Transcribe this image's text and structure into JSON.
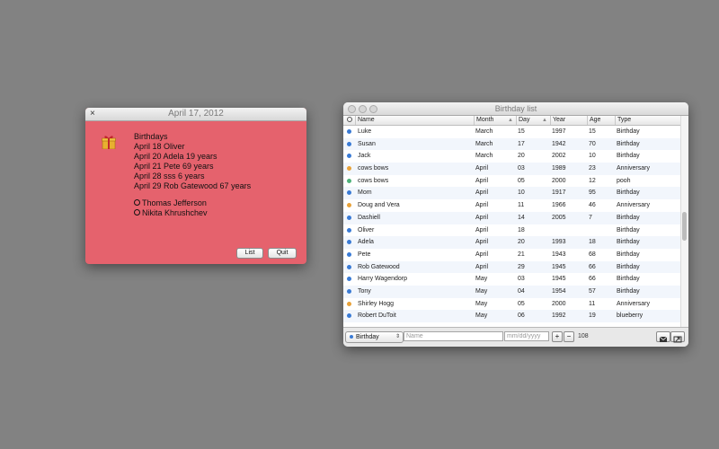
{
  "reminder": {
    "title": "April 17, 2012",
    "close_glyph": "×",
    "lines": [
      "Birthdays",
      "April 18 Oliver",
      "April 20 Adela 19 years",
      "April 21 Pete 69 years",
      "April 28 sss 6 years",
      "April 29 Rob Gatewood 67 years"
    ],
    "people": [
      "Thomas Jefferson",
      "Nikita Khrushchev"
    ],
    "list_button": "List",
    "quit_button": "Quit",
    "icon": "gift-icon"
  },
  "list_window": {
    "title": "Birthday list",
    "columns": [
      "Name",
      "Month",
      "Day",
      "Year",
      "Age",
      "Type"
    ],
    "rows": [
      {
        "name": "Luke",
        "month": "March",
        "day": "15",
        "year": "1997",
        "age": "15",
        "type": "Birthday",
        "status": "blue"
      },
      {
        "name": "Susan",
        "month": "March",
        "day": "17",
        "year": "1942",
        "age": "70",
        "type": "Birthday",
        "status": "blue"
      },
      {
        "name": "Jack",
        "month": "March",
        "day": "20",
        "year": "2002",
        "age": "10",
        "type": "Birthday",
        "status": "blue"
      },
      {
        "name": "cows bows",
        "month": "April",
        "day": "03",
        "year": "1989",
        "age": "23",
        "type": "Anniversary",
        "status": "orange"
      },
      {
        "name": "cows bows",
        "month": "April",
        "day": "05",
        "year": "2000",
        "age": "12",
        "type": "pooh",
        "status": "green"
      },
      {
        "name": "Mom",
        "month": "April",
        "day": "10",
        "year": "1917",
        "age": "95",
        "type": "Birthday",
        "status": "blue"
      },
      {
        "name": "Doug and Vera",
        "month": "April",
        "day": "11",
        "year": "1966",
        "age": "46",
        "type": "Anniversary",
        "status": "orange"
      },
      {
        "name": "Dashiell",
        "month": "April",
        "day": "14",
        "year": "2005",
        "age": "7",
        "type": "Birthday",
        "status": "blue"
      },
      {
        "name": "Oliver",
        "month": "April",
        "day": "18",
        "year": "",
        "age": "",
        "type": "Birthday",
        "status": "blue"
      },
      {
        "name": "Adela",
        "month": "April",
        "day": "20",
        "year": "1993",
        "age": "18",
        "type": "Birthday",
        "status": "blue"
      },
      {
        "name": "Pete",
        "month": "April",
        "day": "21",
        "year": "1943",
        "age": "68",
        "type": "Birthday",
        "status": "blue"
      },
      {
        "name": "Rob Gatewood",
        "month": "April",
        "day": "29",
        "year": "1945",
        "age": "66",
        "type": "Birthday",
        "status": "blue"
      },
      {
        "name": "Harry Wagendorp",
        "month": "May",
        "day": "03",
        "year": "1945",
        "age": "66",
        "type": "Birthday",
        "status": "blue"
      },
      {
        "name": "Tony",
        "month": "May",
        "day": "04",
        "year": "1954",
        "age": "57",
        "type": "Birthday",
        "status": "blue"
      },
      {
        "name": "Shirley Hogg",
        "month": "May",
        "day": "05",
        "year": "2000",
        "age": "11",
        "type": "Anniversary",
        "status": "orange"
      },
      {
        "name": "Robert DuToit",
        "month": "May",
        "day": "06",
        "year": "1992",
        "age": "19",
        "type": "blueberry",
        "status": "blue"
      }
    ],
    "toolbar": {
      "type_select": "Birthday",
      "name_placeholder": "Name",
      "date_placeholder": "mm/dd/yyyy",
      "add_label": "+",
      "remove_label": "−",
      "count": "108"
    }
  },
  "colors": {
    "desktop": "#828282",
    "reminder_bg": "#e5626d",
    "status_blue": "#3a7bd5",
    "status_orange": "#e8a23a",
    "status_green": "#4fb27a"
  }
}
